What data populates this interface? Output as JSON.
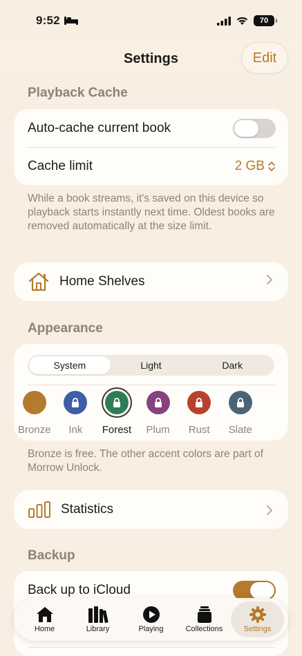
{
  "status": {
    "time": "9:52",
    "battery": "70"
  },
  "nav": {
    "title": "Settings",
    "edit": "Edit"
  },
  "playback": {
    "header": "Playback Cache",
    "auto_cache_label": "Auto-cache current book",
    "auto_cache_on": false,
    "cache_limit_label": "Cache limit",
    "cache_limit_value": "2 GB",
    "footnote": "While a book streams, it's saved on this device so playback starts instantly next time. Oldest books are removed automatically at the size limit."
  },
  "home_shelves": {
    "label": "Home Shelves"
  },
  "appearance": {
    "header": "Appearance",
    "modes": [
      "System",
      "Light",
      "Dark"
    ],
    "selected_mode": "System",
    "accents": [
      {
        "name": "Bronze",
        "color": "#b57a2b",
        "locked": false,
        "selected": false
      },
      {
        "name": "Ink",
        "color": "#3e5ea8",
        "locked": true,
        "selected": false
      },
      {
        "name": "Forest",
        "color": "#2e7d55",
        "locked": true,
        "selected": true
      },
      {
        "name": "Plum",
        "color": "#87417f",
        "locked": true,
        "selected": false
      },
      {
        "name": "Rust",
        "color": "#b8432b",
        "locked": true,
        "selected": false
      },
      {
        "name": "Slate",
        "color": "#4b6577",
        "locked": true,
        "selected": false
      }
    ],
    "footnote": "Bronze is free. The other accent colors are part of Morrow Unlock."
  },
  "statistics": {
    "label": "Statistics"
  },
  "backup": {
    "header": "Backup",
    "icloud_label": "Back up to iCloud",
    "icloud_on": true
  },
  "tabs": [
    {
      "label": "Home",
      "icon": "house-icon",
      "active": false
    },
    {
      "label": "Library",
      "icon": "books-icon",
      "active": false
    },
    {
      "label": "Playing",
      "icon": "play-circle-icon",
      "active": false
    },
    {
      "label": "Collections",
      "icon": "stack-icon",
      "active": false
    },
    {
      "label": "Settings",
      "icon": "gear-icon",
      "active": true
    }
  ],
  "colors": {
    "accent": "#b57a2b",
    "background": "#f8efe2",
    "card": "#fffdf9"
  }
}
